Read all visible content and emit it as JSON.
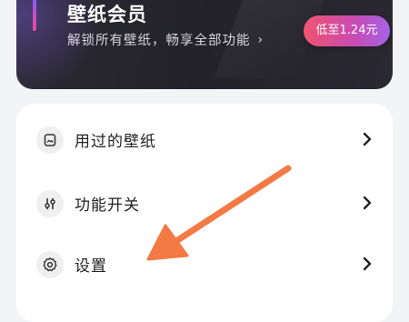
{
  "vip": {
    "title": "壁纸会员",
    "subtitle": "解锁所有壁纸，畅享全部功能",
    "subtitle_chevron": "›",
    "price_button": "低至1.24元"
  },
  "menu": {
    "items": [
      {
        "label": "用过的壁纸",
        "icon": "wallpaper-icon"
      },
      {
        "label": "功能开关",
        "icon": "sliders-icon"
      },
      {
        "label": "设置",
        "icon": "gear-icon"
      }
    ]
  },
  "colors": {
    "annotation_arrow": "#f47a45",
    "price_gradient_start": "#f0526c",
    "price_gradient_end": "#a464e6",
    "banner_dark": "#25242c"
  }
}
